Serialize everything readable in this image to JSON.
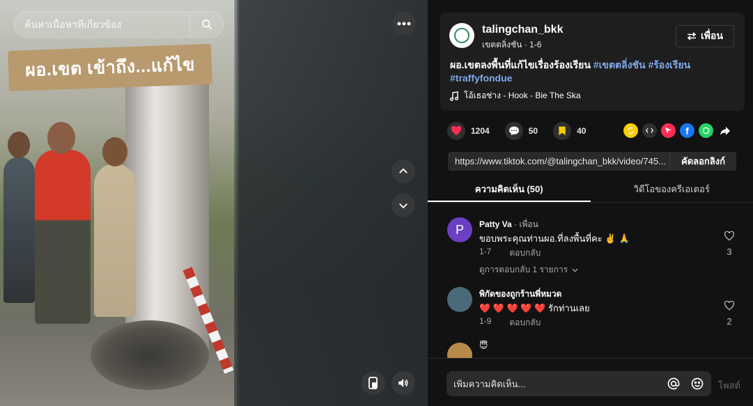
{
  "search": {
    "placeholder": "ค้นหาเนื้อหาที่เกี่ยวข้อง"
  },
  "video": {
    "overlay_caption": "ผอ.เขต เข้าถึง...แก้ไข"
  },
  "post": {
    "username": "talingchan_bkk",
    "subtitle": "เขตตลิ่งชัน · 1-6",
    "friend_button": "เพื่อน",
    "description_text": "ผอ.เขตลงพื้นที่แก้ไขเรื่องร้องเรียน ",
    "hashtags": [
      "#เขตตลิ่งชัน",
      "#ร้องเรียน",
      "#traffyfondue"
    ],
    "music": "โอ้เธอช่าง - Hook - Bie The Ska"
  },
  "actions": {
    "likes": "1204",
    "comments": "50",
    "saves": "40"
  },
  "share_link": {
    "url": "https://www.tiktok.com/@talingchan_bkk/video/745...",
    "copy_label": "คัดลอกลิงก์"
  },
  "tabs": [
    {
      "label": "ความคิดเห็น (50)",
      "active": true
    },
    {
      "label": "วิดีโอของครีเอเตอร์",
      "active": false
    }
  ],
  "comments": [
    {
      "name": "Patty Va",
      "badge": " · เพื่อน",
      "avatar_letter": "P",
      "avatar_color": "#6b3fc4",
      "text": "ขอบพระคุณท่านผอ.ที่ลงพื้นที่คะ ✌️ 🙏",
      "date": "1-7",
      "reply_label": "ตอบกลับ",
      "likes": "3",
      "view_replies": "ดูการตอบกลับ 1 รายการ"
    },
    {
      "name": "พิกัดของถูกร้านพี่หมวด",
      "badge": "",
      "avatar_letter": "",
      "avatar_color": "#4a6a7a",
      "text": "❤️ ❤️ ❤️ ❤️ ❤️ รักท่านเลย",
      "date": "1-9",
      "reply_label": "ตอบกลับ",
      "likes": "2"
    },
    {
      "name": "😇",
      "badge": "",
      "avatar_letter": "",
      "avatar_color": "#b88a4a",
      "text": "",
      "date": "",
      "reply_label": "",
      "likes": ""
    }
  ],
  "comment_box": {
    "placeholder": "เพิ่มความคิดเห็น...",
    "post_label": "โพสต์"
  },
  "colors": {
    "like": "#fe2c55",
    "save": "#facd00",
    "hashtag": "#7fa9e8"
  }
}
